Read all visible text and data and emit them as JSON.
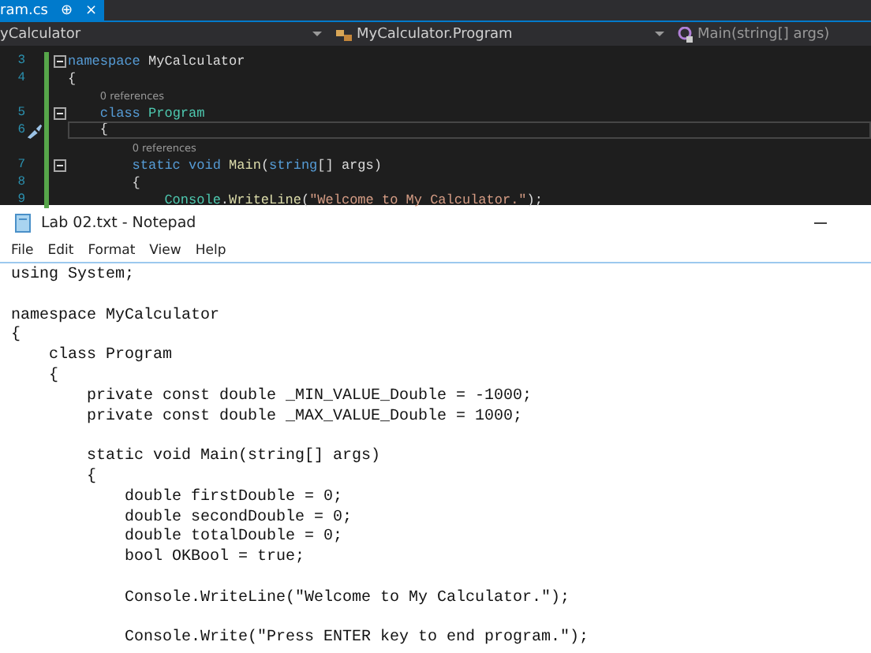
{
  "editor": {
    "tab": {
      "title": "ram.cs",
      "pin": "⊕",
      "close": "×"
    },
    "nav": {
      "project": "yCalculator",
      "class": "MyCalculator.Program",
      "member": "Main(string[] args)"
    },
    "lines": [
      {
        "number": "3",
        "fold": true,
        "current": false,
        "tokens": [
          {
            "kind": "keyword",
            "text": "namespace "
          },
          {
            "kind": "plain",
            "text": "MyCalculator"
          }
        ]
      },
      {
        "number": "4",
        "fold": false,
        "current": false,
        "tokens": [
          {
            "kind": "plain",
            "text": "{"
          }
        ]
      },
      {
        "number": "5",
        "fold": true,
        "current": false,
        "lens": "0 references",
        "tokens": [
          {
            "kind": "keyword",
            "text": "    class "
          },
          {
            "kind": "type",
            "text": "Program"
          }
        ]
      },
      {
        "number": "6",
        "fold": false,
        "current": true,
        "tokens": [
          {
            "kind": "plain",
            "text": "    {"
          }
        ]
      },
      {
        "number": "7",
        "fold": true,
        "current": false,
        "lens": "0 references",
        "tokens": [
          {
            "kind": "keyword",
            "text": "        static void "
          },
          {
            "kind": "method",
            "text": "Main"
          },
          {
            "kind": "plain",
            "text": "("
          },
          {
            "kind": "keyword",
            "text": "string"
          },
          {
            "kind": "plain",
            "text": "[] args)"
          }
        ]
      },
      {
        "number": "8",
        "fold": false,
        "current": false,
        "tokens": [
          {
            "kind": "plain",
            "text": "        {"
          }
        ]
      },
      {
        "number": "9",
        "fold": false,
        "current": false,
        "tokens": [
          {
            "kind": "type",
            "text": "            Console"
          },
          {
            "kind": "plain",
            "text": "."
          },
          {
            "kind": "method",
            "text": "WriteLine"
          },
          {
            "kind": "plain",
            "text": "("
          },
          {
            "kind": "string",
            "text": "\"Welcome to My Calculator.\""
          },
          {
            "kind": "plain",
            "text": ");"
          }
        ]
      }
    ]
  },
  "notepad": {
    "title": "Lab 02.txt - Notepad",
    "menu": [
      "File",
      "Edit",
      "Format",
      "View",
      "Help"
    ],
    "blocks": [
      [
        "using System;"
      ],
      [
        "namespace MyCalculator",
        "{",
        "    class Program",
        "    {",
        "        private const double _MIN_VALUE_Double = -1000;",
        "        private const double _MAX_VALUE_Double = 1000;"
      ],
      [
        "        static void Main(string[] args)",
        "        {",
        "            double firstDouble = 0;",
        "            double secondDouble = 0;",
        "            double totalDouble = 0;",
        "            bool OKBool = true;"
      ],
      [
        "            Console.WriteLine(\"Welcome to My Calculator.\");"
      ],
      [
        "            Console.Write(\"Press ENTER key to end program.\");"
      ]
    ]
  }
}
